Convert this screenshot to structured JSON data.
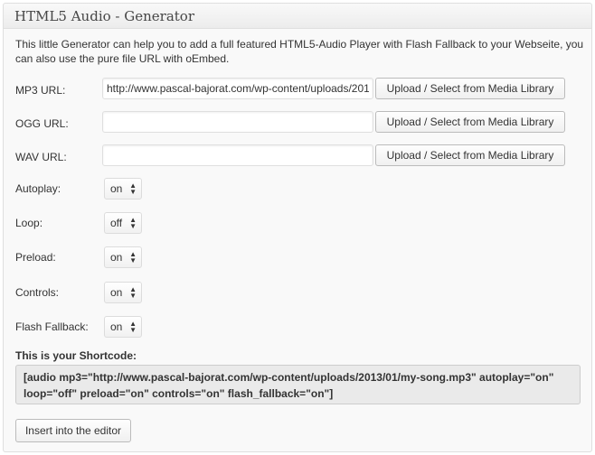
{
  "panel": {
    "title": "HTML5 Audio - Generator"
  },
  "intro": "This little Generator can help you to add a full featured HTML5-Audio Player with Flash Fallback to your Webseite, you can also use the pure file URL with oEmbed.",
  "fields": {
    "mp3": {
      "label": "MP3 URL:",
      "value": "http://www.pascal-bajorat.com/wp-content/uploads/2013/01/my-song.mp3",
      "button": "Upload / Select from Media Library"
    },
    "ogg": {
      "label": "OGG URL:",
      "value": "",
      "button": "Upload / Select from Media Library"
    },
    "wav": {
      "label": "WAV URL:",
      "value": "",
      "button": "Upload / Select from Media Library"
    }
  },
  "options": {
    "autoplay": {
      "label": "Autoplay:",
      "value": "on"
    },
    "loop": {
      "label": "Loop:",
      "value": "off"
    },
    "preload": {
      "label": "Preload:",
      "value": "on"
    },
    "controls": {
      "label": "Controls:",
      "value": "on"
    },
    "flash": {
      "label": "Flash Fallback:",
      "value": "on"
    }
  },
  "shortcode": {
    "title": "This is your Shortcode:",
    "text": "[audio mp3=\"http://www.pascal-bajorat.com/wp-content/uploads/2013/01/my-song.mp3\" autoplay=\"on\" loop=\"off\" preload=\"on\" controls=\"on\" flash_fallback=\"on\"]"
  },
  "insert_button": "Insert into the editor",
  "colors": {
    "panel_bg": "#f9f9f9",
    "border": "#dfdfdf",
    "shortcode_bg": "#eaeaea"
  }
}
